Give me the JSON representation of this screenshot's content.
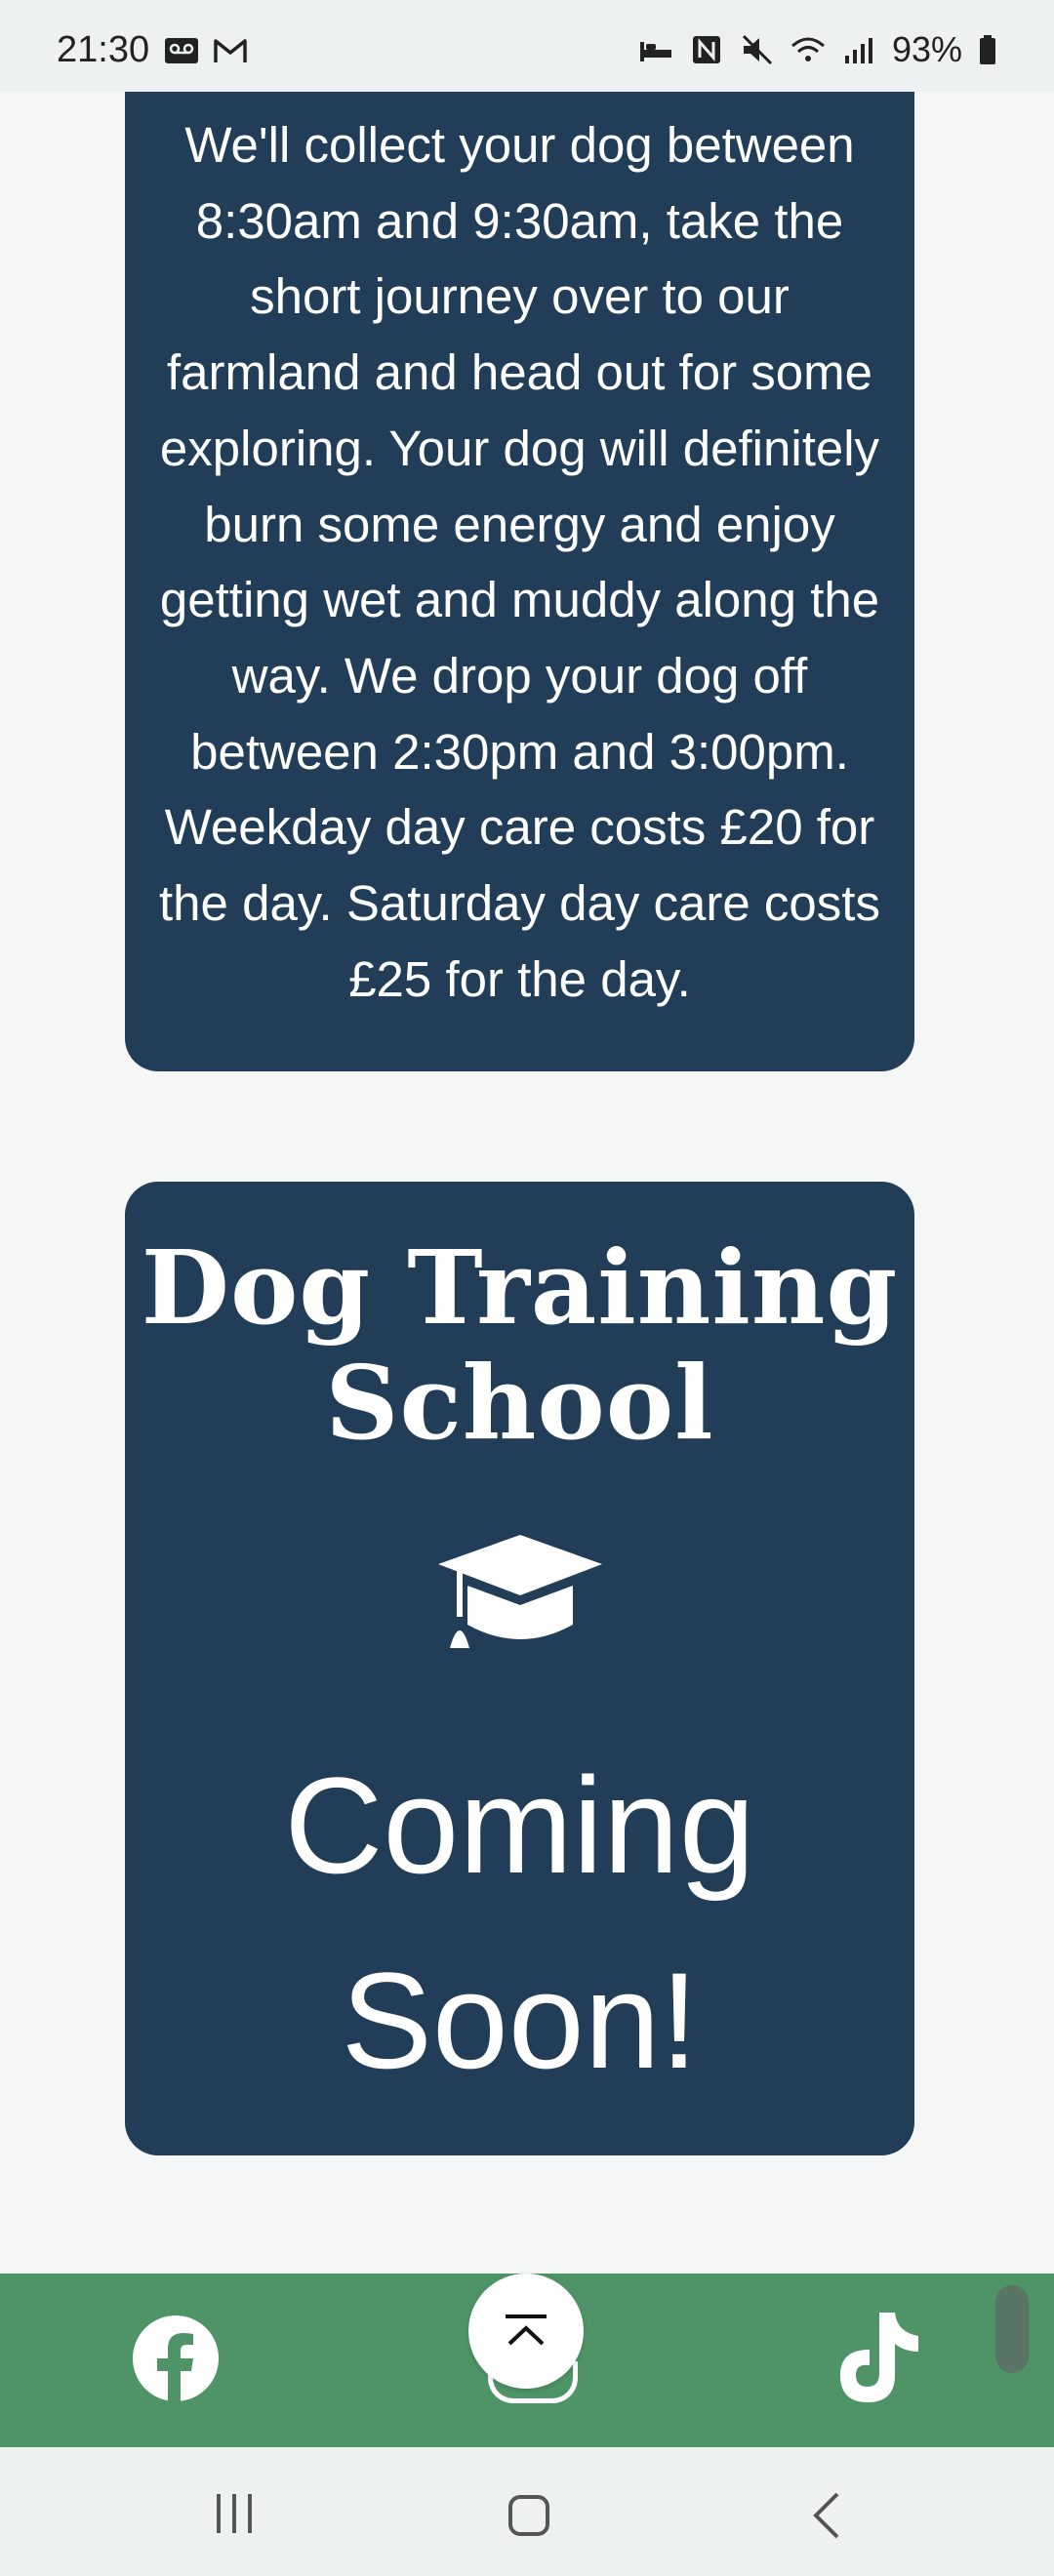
{
  "status_bar": {
    "time": "21:30",
    "battery": "93%",
    "left_icons": [
      "voicemail-icon",
      "gmail-icon"
    ],
    "right_icons": [
      "bed-icon",
      "nfc-icon",
      "mute-icon",
      "wifi-icon",
      "signal-icon",
      "battery-icon"
    ]
  },
  "daycare": {
    "description": "We'll collect your dog between 8:30am and 9:30am, take the short journey over to our farmland and head out for some exploring. Your dog will definitely burn some energy and enjoy getting wet and muddy along the way. We drop your dog off between 2:30pm and 3:00pm. Weekday day care costs £20 for the day. Saturday day care costs £25 for the day."
  },
  "training": {
    "title": "Dog Training School",
    "icon": "graduation-cap-icon",
    "status": "Coming Soon!"
  },
  "bottom_nav": {
    "icons": [
      "facebook-icon",
      "back-to-top-icon",
      "tiktok-icon"
    ],
    "background": "#4f9467"
  },
  "colors": {
    "card": "#223d57",
    "page": "#f5f6f6"
  }
}
